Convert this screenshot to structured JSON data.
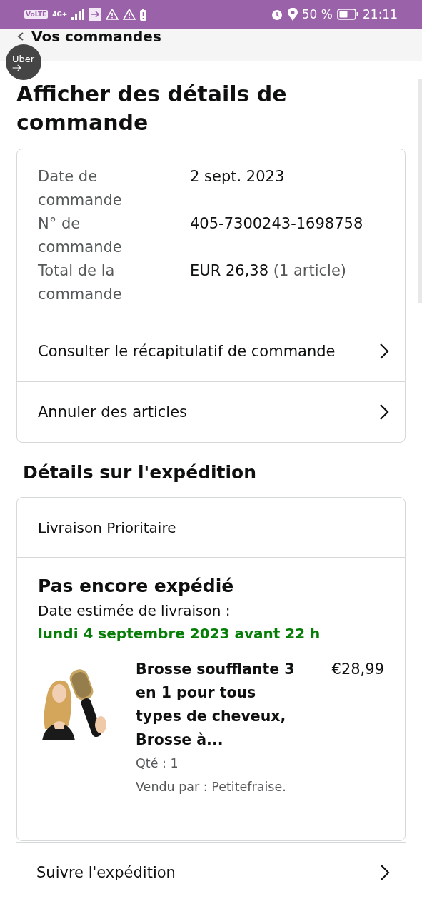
{
  "status_bar": {
    "badges": [
      "VoLTE",
      "4G+"
    ],
    "battery": "50 %",
    "time": "21:11"
  },
  "nav": {
    "back_label": "Vos commandes"
  },
  "overlay_bubble": {
    "label": "Uber"
  },
  "title": "Afficher des détails de commande",
  "order_card": {
    "fields": [
      {
        "label": "Date de commande",
        "value": "2 sept. 2023"
      },
      {
        "label": "N° de commande",
        "value": "405-7300243-1698758"
      },
      {
        "label": "Total de la commande",
        "value": "EUR 26,38",
        "note": "(1 article)"
      }
    ],
    "links": [
      "Consulter le récapitulatif de commande",
      "Annuler des articles"
    ]
  },
  "shipment_heading": "Détails sur l'expédition",
  "shipment_card": {
    "method": "Livraison Prioritaire",
    "status": "Pas encore expédié",
    "estimate_label": "Date estimée de livraison :",
    "estimate_date": "lundi 4 septembre 2023 avant 22 h",
    "item": {
      "title": "Brosse soufflante 3 en 1 pour tous types de cheveux, Brosse à...",
      "price": "€28,99",
      "quantity": "Qté : 1",
      "seller": "Vendu par : Petitefraise."
    }
  },
  "bottom_links": [
    "Suivre l'expédition"
  ]
}
